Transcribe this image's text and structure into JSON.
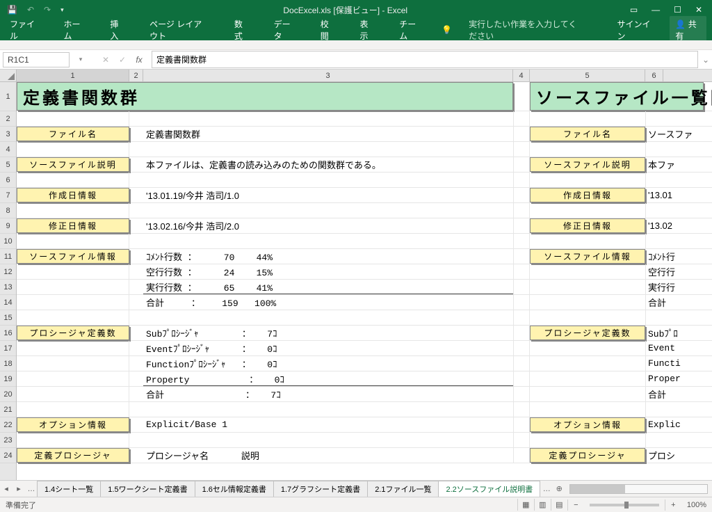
{
  "titlebar": {
    "title": "DocExcel.xls  [保護ビュー] - Excel"
  },
  "ribbon": {
    "tabs": [
      "ファイル",
      "ホーム",
      "挿入",
      "ページ レイアウト",
      "数式",
      "データ",
      "校閲",
      "表示",
      "チーム"
    ],
    "tellme": "実行したい作業を入力してください",
    "signin": "サインイン",
    "share": "共有"
  },
  "fbar": {
    "namebox": "R1C1",
    "formula": "定義書関数群"
  },
  "cols": [
    "1",
    "2",
    "3",
    "4",
    "5",
    "6"
  ],
  "rowLabels": [
    "1",
    "2",
    "3",
    "4",
    "5",
    "6",
    "7",
    "8",
    "9",
    "10",
    "11",
    "12",
    "13",
    "14",
    "15",
    "16",
    "17",
    "18",
    "19",
    "20",
    "21",
    "22",
    "23",
    "24"
  ],
  "sheet": {
    "title1": "定義書関数群",
    "title5": "ソースファイル一覧関数",
    "r3": {
      "label": "ファイル名",
      "val": "定義書関数群",
      "label5": "ファイル名",
      "val6": "ソースファ"
    },
    "r5": {
      "label": "ソースファイル説明",
      "val": "本ファイルは、定義書の読み込みのための関数群である。",
      "label5": "ソースファイル説明",
      "val6": "本ファ"
    },
    "r7": {
      "label": "作成日情報",
      "val": "'13.01.19/今井 浩司/1.0",
      "label5": "作成日情報",
      "val6": "'13.01"
    },
    "r9": {
      "label": "修正日情報",
      "val": "'13.02.16/今井 浩司/2.0",
      "label5": "修正日情報",
      "val6": "'13.02"
    },
    "r11": {
      "label": "ソースファイル情報",
      "val": "ｺﾒﾝﾄ行数 ：     70    44%",
      "label5": "ソースファイル情報",
      "val6": "ｺﾒﾝﾄ行"
    },
    "r12": {
      "val": "空行行数 ：     24    15%",
      "val6": "空行行"
    },
    "r13": {
      "val": "実行行数 ：     65    41%",
      "val6": "実行行"
    },
    "r14": {
      "val": "合計     ：    159   100%",
      "val6": "合計"
    },
    "r16": {
      "label": "プロシージャ定義数",
      "val": "Subﾌﾟﾛｼｰｼﾞｬ        ：   7ｺ",
      "label5": "プロシージャ定義数",
      "val6": "Subﾌﾟﾛ"
    },
    "r17": {
      "val": "Eventﾌﾟﾛｼｰｼﾞｬ      ：   0ｺ",
      "val6": "Event"
    },
    "r18": {
      "val": "Functionﾌﾟﾛｼｰｼﾞｬ   ：   0ｺ",
      "val6": "Functi"
    },
    "r19": {
      "val": "Property           ：   0ｺ",
      "val6": "Proper"
    },
    "r20": {
      "val": "合計               ：   7ｺ",
      "val6": "合計"
    },
    "r22": {
      "label": "オプション情報",
      "val": "Explicit/Base 1",
      "label5": "オプション情報",
      "val6": "Explic"
    },
    "r24": {
      "label": "定義プロシージャ",
      "val": "プロシージャ名      説明",
      "label5": "定義プロシージャ",
      "val6": "プロシ"
    }
  },
  "sheettabs": {
    "items": [
      "1.4シート一覧",
      "1.5ワークシート定義書",
      "1.6セル情報定義書",
      "1.7グラフシート定義書",
      "2.1ファイル一覧",
      "2.2ソースファイル説明書"
    ],
    "active": 5
  },
  "status": {
    "ready": "準備完了",
    "zoom": "100%"
  }
}
